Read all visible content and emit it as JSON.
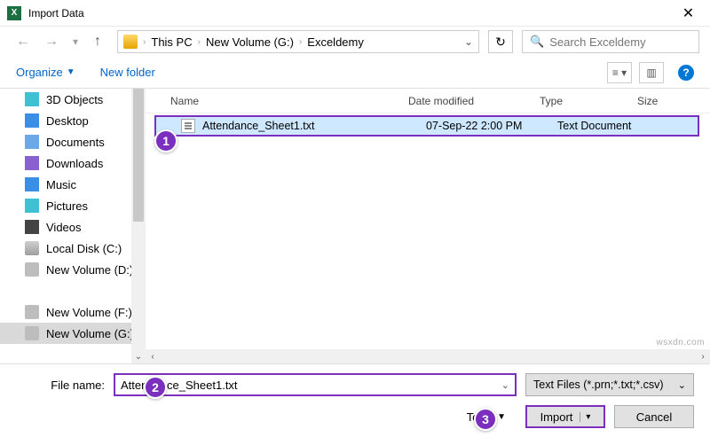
{
  "title": "Import Data",
  "breadcrumb": {
    "a": "This PC",
    "b": "New Volume (G:)",
    "c": "Exceldemy"
  },
  "search_placeholder": "Search Exceldemy",
  "toolbar": {
    "organize": "Organize",
    "newfolder": "New folder"
  },
  "sidebar": {
    "items": [
      {
        "label": "3D Objects",
        "cls": "ic-3d"
      },
      {
        "label": "Desktop",
        "cls": "ic-desk"
      },
      {
        "label": "Documents",
        "cls": "ic-doc"
      },
      {
        "label": "Downloads",
        "cls": "ic-dl"
      },
      {
        "label": "Music",
        "cls": "ic-mus"
      },
      {
        "label": "Pictures",
        "cls": "ic-pic"
      },
      {
        "label": "Videos",
        "cls": "ic-vid"
      },
      {
        "label": "Local Disk (C:)",
        "cls": "ic-disk local"
      },
      {
        "label": "New Volume (D:)",
        "cls": "ic-disk"
      },
      {
        "label": "",
        "cls": ""
      },
      {
        "label": "New Volume (F:)",
        "cls": "ic-disk"
      },
      {
        "label": "New Volume (G:)",
        "cls": "ic-disk",
        "sel": true
      }
    ]
  },
  "columns": {
    "name": "Name",
    "date": "Date modified",
    "type": "Type",
    "size": "Size"
  },
  "files": [
    {
      "name": "Attendance_Sheet1.txt",
      "date": "07-Sep-22 2:00 PM",
      "type": "Text Document",
      "size": ""
    }
  ],
  "filename_label": "File name:",
  "filename_value": "Attendance_Sheet1.txt",
  "filter_label": "Text Files (*.prn;*.txt;*.csv)",
  "tools_label": "Tools",
  "import_btn": "Import",
  "cancel_btn": "Cancel",
  "badges": {
    "b1": "1",
    "b2": "2",
    "b3": "3"
  },
  "watermark": "wsxdn.com"
}
